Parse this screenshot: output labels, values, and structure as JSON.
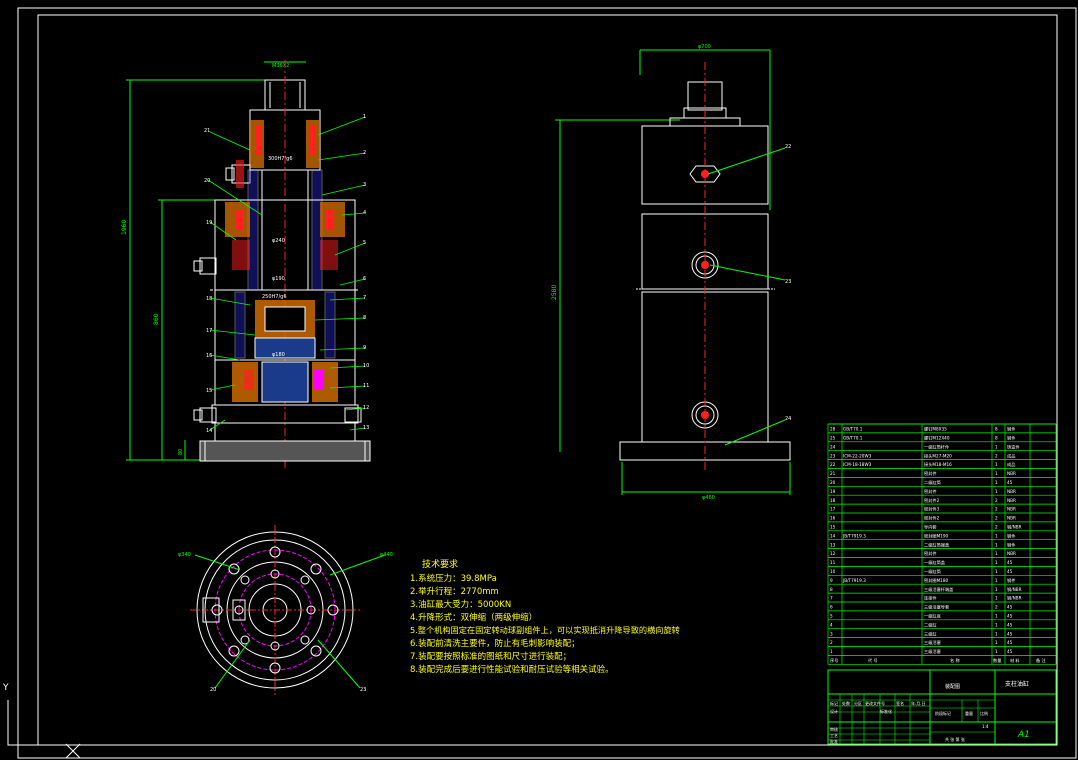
{
  "drawing": {
    "colors": {
      "background": "#000000",
      "frame": "#ffffff",
      "green": "#00ff00",
      "red": "#ff2020",
      "magenta": "#ff00ff",
      "yellow": "#ffff00",
      "cyan": "#00ffff",
      "orange": "#cc6a00",
      "blue": "#3030ff"
    },
    "front_view": {
      "top_dim": "M36X2",
      "height_dim_outer": "1960",
      "height_dim_inner": "860",
      "base_dim": "80",
      "bore_label": "300H7/g6",
      "dia_inner": "φ240",
      "dia_lower": "φ190",
      "piston_label": "250H7/g6",
      "mid_dia": "φ180",
      "callouts_right": [
        "1",
        "2",
        "3",
        "4",
        "5",
        "6",
        "7",
        "8",
        "9",
        "10",
        "11",
        "12",
        "13"
      ],
      "callouts_left": [
        "21",
        "20",
        "19",
        "18",
        "17",
        "16",
        "15",
        "14"
      ]
    },
    "side_view": {
      "top_dim": "φ700",
      "height_dim": "2580",
      "bottom_dim": "φ460",
      "callouts": [
        "22",
        "23",
        "24"
      ]
    },
    "plan_view": {
      "dim_left": "φ340",
      "dim_right": "φ440",
      "callouts": [
        "20",
        "23"
      ]
    },
    "tech_requirements": {
      "title": "技术要求",
      "lines": [
        "1.系统压力：39.8MPa",
        "2.举升行程：2770mm",
        "3.油缸最大受力：5000KN",
        "4.升降形式：双伸缩（两级伸缩）",
        "5.整个机构固定在固定转动球副组件上，可以实现抵消升降导致的横向旋转",
        "6.装配前清洗主要件，防止有毛刺影响装配；",
        "7.装配要按照标准的图纸和尺寸进行装配；",
        "8.装配完成后要进行性能试验和耐压试验等相关试验。"
      ]
    },
    "bom": {
      "rows": [
        {
          "no": "28",
          "std": "GB/T70.1",
          "name": "螺钉M8X35",
          "qty": "8",
          "mat": "钢件"
        },
        {
          "no": "25",
          "std": "GB/T70.1",
          "name": "螺钉M12X40",
          "qty": "8",
          "mat": "钢件"
        },
        {
          "no": "24",
          "std": "",
          "name": "一级缸筒杆件",
          "qty": "1",
          "mat": "铸造件"
        },
        {
          "no": "23",
          "std": "ICM-22-20W3",
          "name": "接头M27-M20",
          "qty": "2",
          "mat": "成品"
        },
        {
          "no": "22",
          "std": "ICM-18-18W3",
          "name": "接头M18-M16",
          "qty": "1",
          "mat": "成品"
        },
        {
          "no": "21",
          "std": "",
          "name": "密封件",
          "qty": "1",
          "mat": "NBR"
        },
        {
          "no": "20",
          "std": "",
          "name": "二级缸筒",
          "qty": "1",
          "mat": "45"
        },
        {
          "no": "19",
          "std": "",
          "name": "密封件",
          "qty": "1",
          "mat": "NBR"
        },
        {
          "no": "18",
          "std": "",
          "name": "密封件2",
          "qty": "2",
          "mat": "NBR"
        },
        {
          "no": "17",
          "std": "",
          "name": "密封件3",
          "qty": "2",
          "mat": "NBR"
        },
        {
          "no": "16",
          "std": "",
          "name": "密封件2",
          "qty": "2",
          "mat": "NBR"
        },
        {
          "no": "15",
          "std": "",
          "name": "导向套",
          "qty": "2",
          "mat": "钢/NBR"
        },
        {
          "no": "14",
          "std": "JB/T7919.3",
          "name": "密封圈M190",
          "qty": "1",
          "mat": "钢件"
        },
        {
          "no": "13",
          "std": "",
          "name": "二级缸筒端盖",
          "qty": "1",
          "mat": "钢件"
        },
        {
          "no": "12",
          "std": "",
          "name": "密封件",
          "qty": "1",
          "mat": "NBR"
        },
        {
          "no": "11",
          "std": "",
          "name": "一级缸筒盖",
          "qty": "1",
          "mat": "45"
        },
        {
          "no": "10",
          "std": "",
          "name": "一级缸筒",
          "qty": "1",
          "mat": "45"
        },
        {
          "no": "9",
          "std": "JB/T7919.3",
          "name": "密封圈M180",
          "qty": "1",
          "mat": "钢件"
        },
        {
          "no": "8",
          "std": "",
          "name": "三级活塞杆端盖",
          "qty": "1",
          "mat": "钢/NBR"
        },
        {
          "no": "7",
          "std": "",
          "name": "连接件",
          "qty": "1",
          "mat": "钢/NBR"
        },
        {
          "no": "6",
          "std": "",
          "name": "三级活塞导套",
          "qty": "2",
          "mat": "45"
        },
        {
          "no": "5",
          "std": "",
          "name": "一级缸底",
          "qty": "1",
          "mat": "45"
        },
        {
          "no": "4",
          "std": "",
          "name": "二级缸",
          "qty": "1",
          "mat": "45"
        },
        {
          "no": "3",
          "std": "",
          "name": "三级缸",
          "qty": "1",
          "mat": "45"
        },
        {
          "no": "2",
          "std": "",
          "name": "三级活塞",
          "qty": "1",
          "mat": "45"
        },
        {
          "no": "1",
          "std": "",
          "name": "三级活塞",
          "qty": "1",
          "mat": "45"
        }
      ],
      "header": {
        "no": "序号",
        "std": "代 号",
        "name": "名 称",
        "qty": "数量",
        "mat": "材 料",
        "note": "备 注"
      }
    },
    "title_block": {
      "drawing_name": "支柱油缸",
      "school": "装配图",
      "sheet_size": "A1",
      "scale": "1:4",
      "sheets": "共 张 第 张",
      "labels": [
        "标记",
        "处数",
        "分区",
        "更改文件号",
        "签名",
        "年.月.日",
        "设计",
        "标准化",
        "阶段标记",
        "重量",
        "比例",
        "审核",
        "工艺",
        "批准"
      ]
    }
  }
}
